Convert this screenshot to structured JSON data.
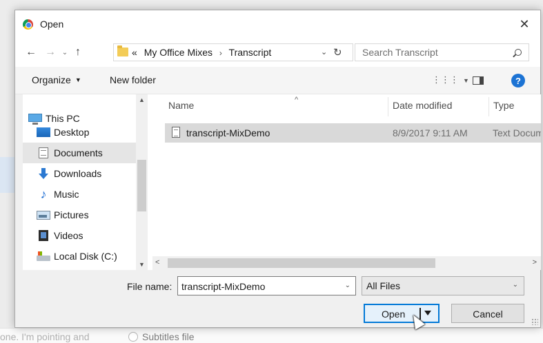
{
  "background": {
    "bottom_text": "one. I'm pointing and",
    "radio_label": "Subtitles file"
  },
  "dialog": {
    "title": "Open",
    "icons": {
      "app": "chrome-icon",
      "close": "close-icon"
    }
  },
  "navigation": {
    "back_glyph": "←",
    "forward_glyph": "→",
    "recent_glyph": "⌄",
    "up_glyph": "↑",
    "breadcrumb_prefix": "«",
    "breadcrumb": [
      "My Office Mixes",
      "Transcript"
    ],
    "breadcrumb_sep": "›",
    "address_dropdown_glyph": "⌄",
    "refresh_glyph": "↻",
    "search_placeholder": "Search Transcript"
  },
  "toolbar": {
    "organize_label": "Organize",
    "organize_caret": "▼",
    "new_folder_label": "New folder",
    "view_glyph": "⋮⋮⋮",
    "view_caret": "▼",
    "help_label": "?"
  },
  "nav_pane": {
    "items": [
      {
        "label": "This PC",
        "icon": "computer-icon"
      },
      {
        "label": "Desktop",
        "icon": "desktop-icon"
      },
      {
        "label": "Documents",
        "icon": "documents-icon",
        "selected": true
      },
      {
        "label": "Downloads",
        "icon": "downloads-icon"
      },
      {
        "label": "Music",
        "icon": "music-icon"
      },
      {
        "label": "Pictures",
        "icon": "pictures-icon"
      },
      {
        "label": "Videos",
        "icon": "videos-icon"
      },
      {
        "label": "Local Disk (C:)",
        "icon": "disk-icon"
      }
    ]
  },
  "file_list": {
    "columns": [
      "Name",
      "Date modified",
      "Type"
    ],
    "sort_glyph": "^",
    "rows": [
      {
        "name": "transcript-MixDemo",
        "date": "8/9/2017 9:11 AM",
        "type": "Text Document",
        "icon": "text-file-icon"
      }
    ]
  },
  "scroll": {
    "up": "▲",
    "down": "▼",
    "left": "<",
    "right": ">"
  },
  "bottom": {
    "file_name_label": "File name:",
    "file_name_value": "transcript-MixDemo",
    "filter_value": "All Files",
    "dropdown_glyph": "⌄",
    "open_label": "Open",
    "cancel_label": "Cancel"
  }
}
